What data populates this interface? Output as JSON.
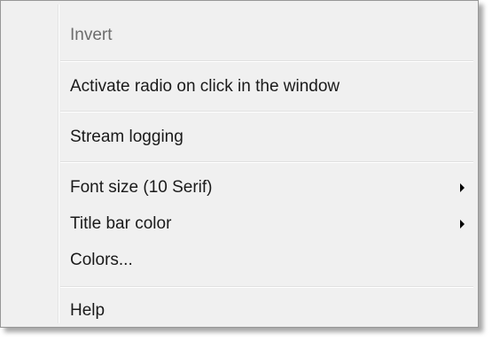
{
  "menu": {
    "items": [
      {
        "label": "Invert",
        "enabled": false,
        "submenu": false
      },
      {
        "label": "Activate radio on click in the window",
        "enabled": true,
        "submenu": false
      },
      {
        "label": "Stream logging",
        "enabled": true,
        "submenu": false
      },
      {
        "label": "Font size (10 Serif)",
        "enabled": true,
        "submenu": true,
        "arrow_icon": "submenu-arrow-icon"
      },
      {
        "label": "Title bar color",
        "enabled": true,
        "submenu": true,
        "arrow_icon": "submenu-arrow-icon"
      },
      {
        "label": "Colors...",
        "enabled": true,
        "submenu": false
      },
      {
        "label": "Help",
        "enabled": true,
        "submenu": false
      }
    ]
  },
  "colors": {
    "menu_background": "#f0f0f0",
    "disabled_text": "#6d6d6d",
    "text": "#1a1a1a",
    "border": "#979797"
  }
}
